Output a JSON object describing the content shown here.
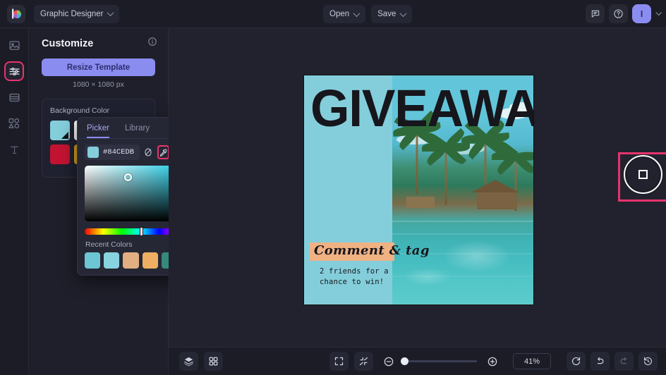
{
  "topbar": {
    "logo": "brand-logo-icon",
    "workspace": {
      "label": "Graphic Designer",
      "icon": "chevron-down-icon"
    },
    "open": {
      "label": "Open",
      "icon": "chevron-down-icon"
    },
    "save": {
      "label": "Save",
      "icon": "chevron-down-icon"
    },
    "comment_icon": "comment-icon",
    "help_icon": "help-circle-icon",
    "avatar": {
      "initial": "I",
      "color": "#8b8cf0",
      "icon": "chevron-down-icon"
    }
  },
  "rail": {
    "items": [
      {
        "name": "image-icon",
        "label": "Images",
        "active": false
      },
      {
        "name": "sliders-icon",
        "label": "Customize",
        "active": true
      },
      {
        "name": "layout-icon",
        "label": "Layouts",
        "active": false
      },
      {
        "name": "shapes-icon",
        "label": "Shapes",
        "active": false
      },
      {
        "name": "text-icon",
        "label": "Text",
        "active": false
      }
    ],
    "active_outline_color": "#e8336d"
  },
  "panel": {
    "title": "Customize",
    "info_icon": "info-circle-icon",
    "resize_button": "Resize Template",
    "dimensions": "1080 × 1080 px",
    "background_color_label": "Background Color",
    "swatches_row1": [
      "#84CEDB",
      "#FFFFFF"
    ],
    "swatches_row2": [
      "#C21432",
      "#D9A21B"
    ],
    "selected_swatch": "#84CEDB"
  },
  "picker": {
    "tabs": [
      {
        "label": "Picker",
        "active": true
      },
      {
        "label": "Library",
        "active": false
      }
    ],
    "hex_value": "#84CEDB",
    "swatch_color": "#84CEDB",
    "tools": [
      {
        "name": "no-color-icon",
        "selected": false
      },
      {
        "name": "eyedropper-icon",
        "selected": true
      },
      {
        "name": "palette-grid-icon",
        "selected": false
      },
      {
        "name": "add-color-icon",
        "selected": false
      }
    ],
    "recent_colors_label": "Recent Colors",
    "recent_colors": [
      "#6EC6D4",
      "#88D3E0",
      "#E2AF82",
      "#EFAE62",
      "#36897B",
      "#FFFFFF"
    ]
  },
  "canvas": {
    "headline": "GIVEAWAY",
    "script_text": "Comment & tag",
    "sub_text": "2 friends for a\nchance to win!",
    "background_color": "#84CEDB",
    "band_color": "#F0B183",
    "selection_color": "#e8336d",
    "loupe_icon": "eyedropper-loupe-icon"
  },
  "bottombar": {
    "layers_icon": "layers-icon",
    "grid_icon": "grid-icon",
    "fit_icon": "fit-to-screen-icon",
    "shrink_icon": "shrink-icon",
    "zoom_out_icon": "zoom-out-icon",
    "zoom_in_icon": "zoom-in-icon",
    "zoom_value": "41%",
    "reset_icon": "reset-icon",
    "undo_icon": "undo-icon",
    "redo_icon": "redo-icon",
    "history_icon": "history-icon"
  }
}
